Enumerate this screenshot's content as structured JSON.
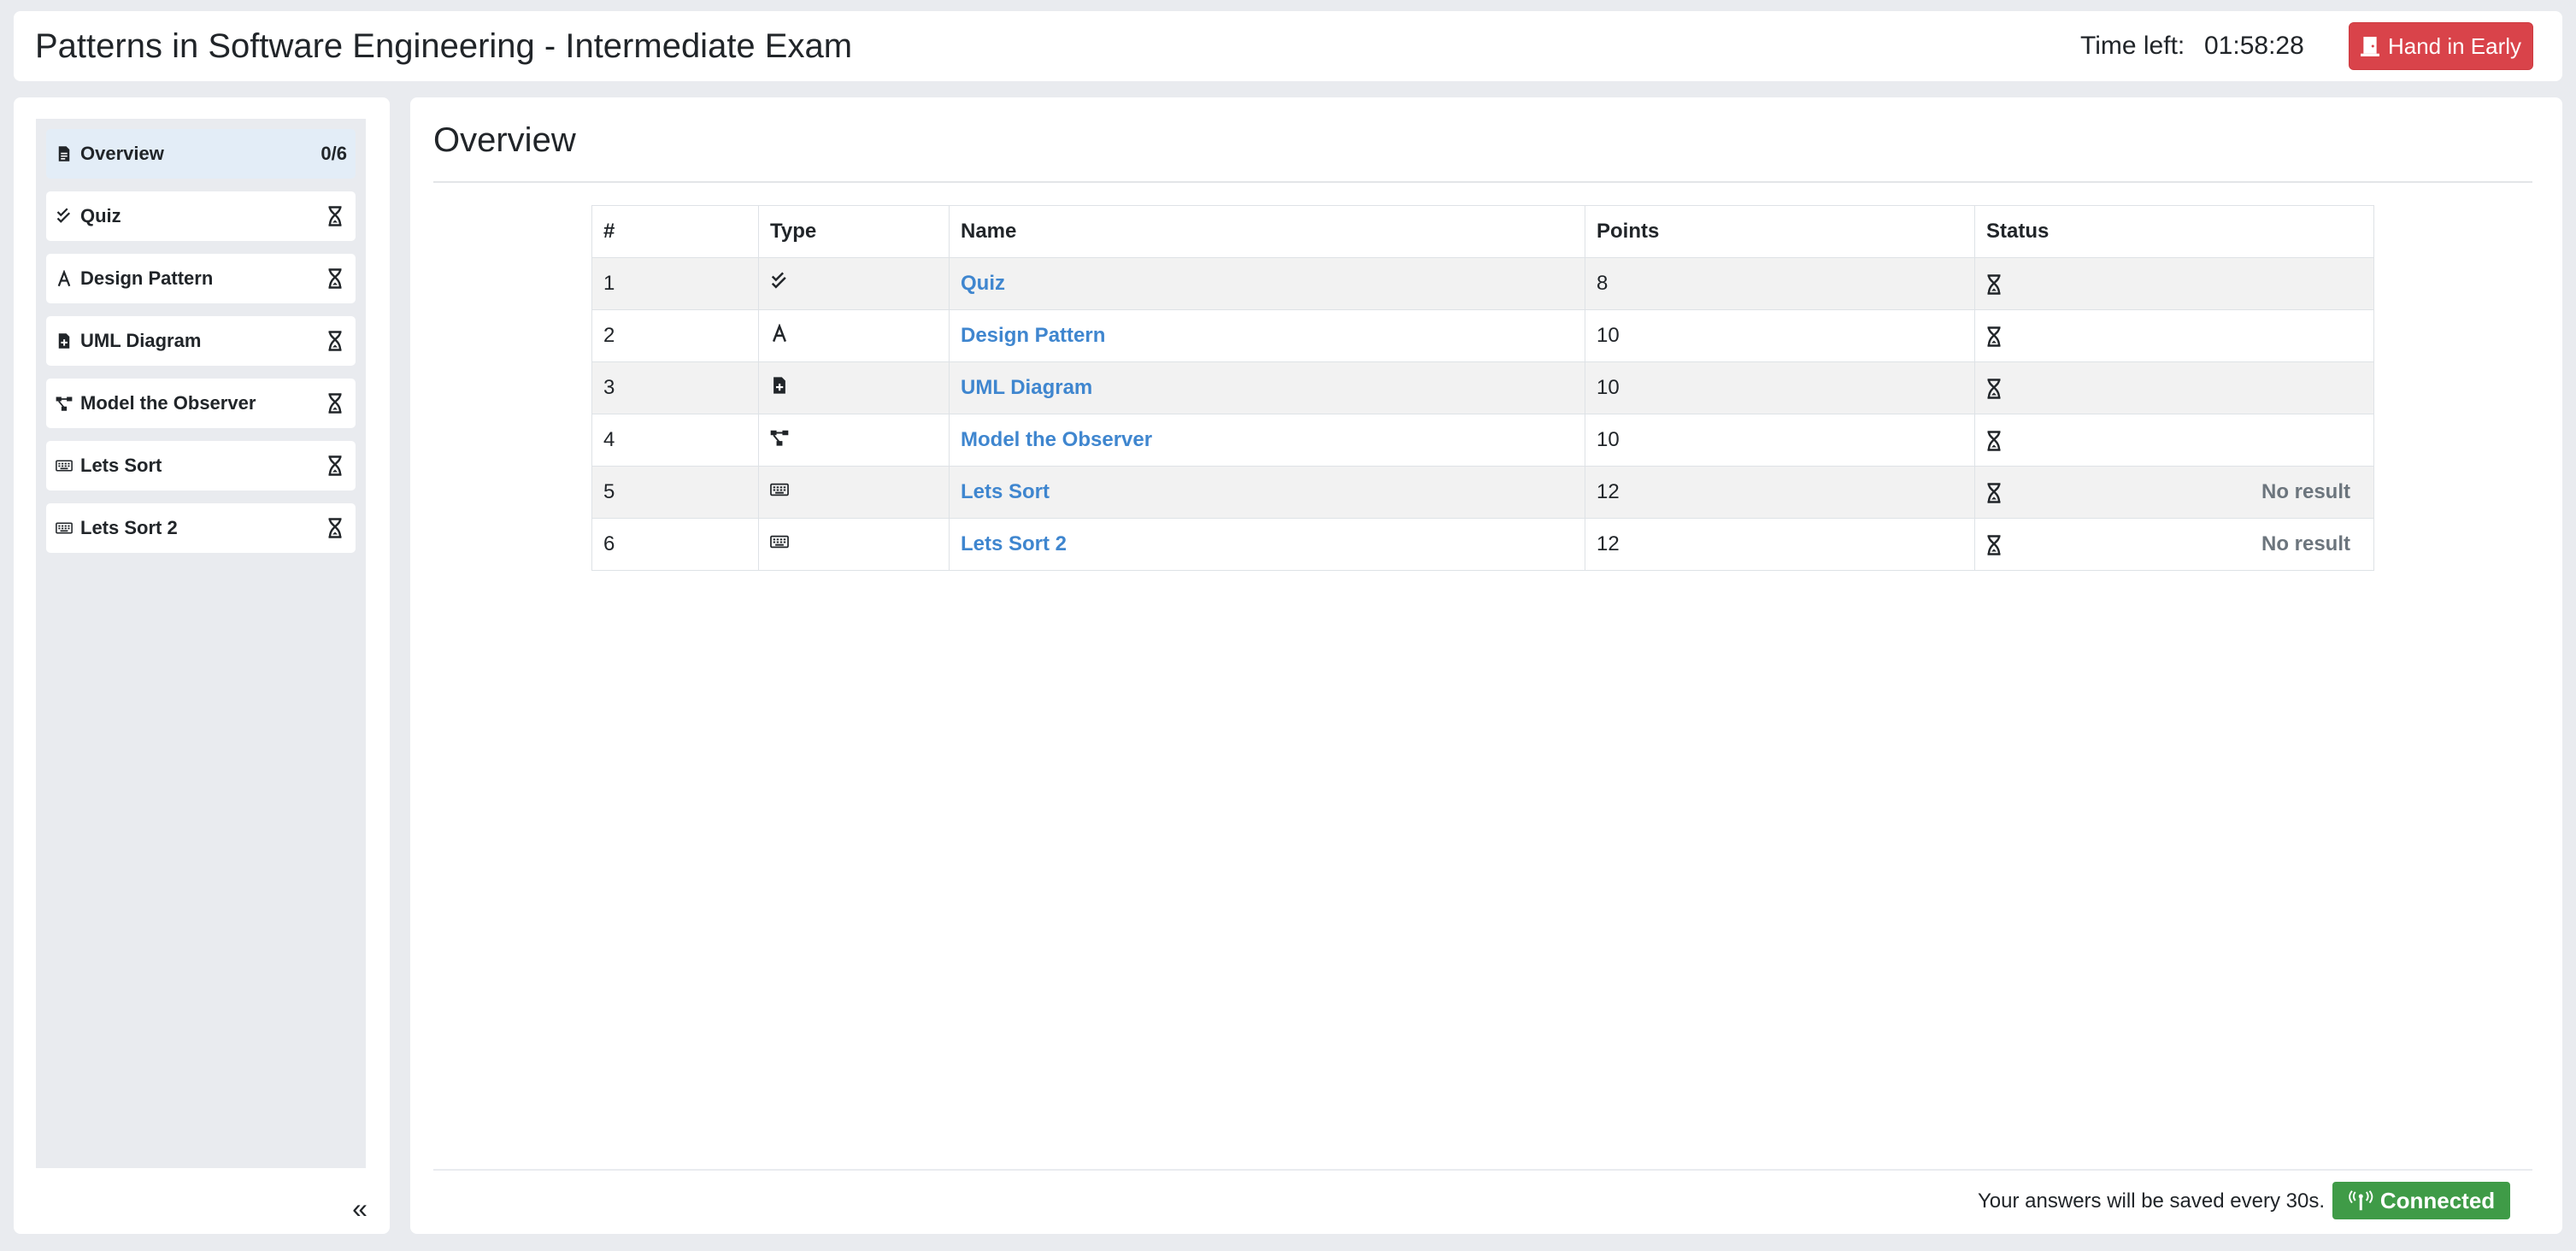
{
  "header": {
    "title": "Patterns in Software Engineering - Intermediate Exam",
    "time_label": "Time left:",
    "time_value": "01:58:28",
    "hand_in_label": "Hand in Early"
  },
  "sidebar": {
    "items": [
      {
        "label": "Overview",
        "icon": "file-icon",
        "status": "0/6"
      },
      {
        "label": "Quiz",
        "icon": "double-check-icon",
        "status": "hourglass-icon"
      },
      {
        "label": "Design Pattern",
        "icon": "font-a-icon",
        "status": "hourglass-icon"
      },
      {
        "label": "UML Diagram",
        "icon": "file-plus-icon",
        "status": "hourglass-icon"
      },
      {
        "label": "Model the Observer",
        "icon": "diagram-nodes-icon",
        "status": "hourglass-icon"
      },
      {
        "label": "Lets Sort",
        "icon": "keyboard-icon",
        "status": "hourglass-icon"
      },
      {
        "label": "Lets Sort 2",
        "icon": "keyboard-icon",
        "status": "hourglass-icon"
      }
    ],
    "collapse_label": "«"
  },
  "main": {
    "title": "Overview",
    "table": {
      "headers": [
        "#",
        "Type",
        "Name",
        "Points",
        "Status"
      ],
      "rows": [
        {
          "num": "1",
          "type_icon": "double-check-icon",
          "name": "Quiz",
          "points": "8",
          "status_icon": "hourglass-icon",
          "result": ""
        },
        {
          "num": "2",
          "type_icon": "font-a-icon",
          "name": "Design Pattern",
          "points": "10",
          "status_icon": "hourglass-icon",
          "result": ""
        },
        {
          "num": "3",
          "type_icon": "file-plus-icon",
          "name": "UML Diagram",
          "points": "10",
          "status_icon": "hourglass-icon",
          "result": ""
        },
        {
          "num": "4",
          "type_icon": "diagram-nodes-icon",
          "name": "Model the Observer",
          "points": "10",
          "status_icon": "hourglass-icon",
          "result": ""
        },
        {
          "num": "5",
          "type_icon": "keyboard-icon",
          "name": "Lets Sort",
          "points": "12",
          "status_icon": "hourglass-icon",
          "result": "No result"
        },
        {
          "num": "6",
          "type_icon": "keyboard-icon",
          "name": "Lets Sort 2",
          "points": "12",
          "status_icon": "hourglass-icon",
          "result": "No result"
        }
      ]
    }
  },
  "footer": {
    "save_note": "Your answers will be saved every 30s.",
    "connection_label": "Connected",
    "connection_icon": "broadcast-tower-icon"
  },
  "colors": {
    "danger": "#d9434a",
    "link": "#3f86cf",
    "success": "#3f9b47",
    "active_item": "#e3edf7",
    "page_bg": "#e9ebef"
  }
}
